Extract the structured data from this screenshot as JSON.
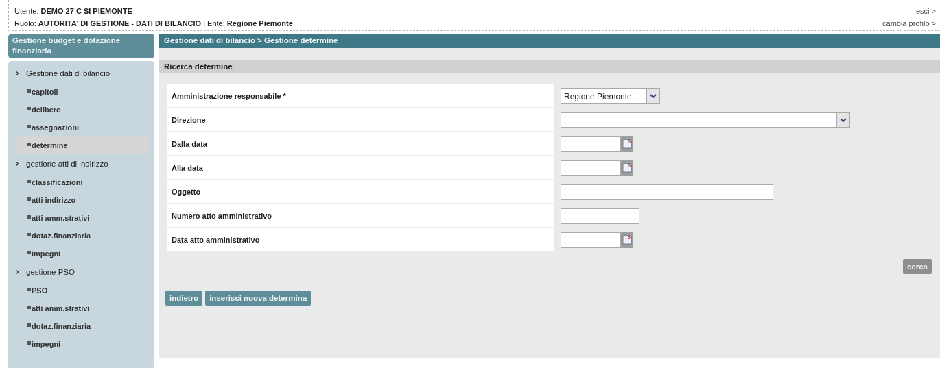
{
  "header": {
    "user": "Utente: **DEMO 27 C SI PIEMONTE**",
    "role": "Ruolo: **AUTORITA' DI GESTIONE - DATI DI BILANCIO** | Ente: **Regione Piemonte**",
    "links": [
      "esci >",
      "cambia profilo >"
    ]
  },
  "sidebar": {
    "title": "Gestione budget e dotazione finanziaria",
    "groups": [
      {
        "label": "Gestione dati di bilancio",
        "expanded": true,
        "children": [
          {
            "label": "capitoli",
            "selected": false
          },
          {
            "label": "delibere",
            "selected": false
          },
          {
            "label": "assegnazioni",
            "selected": false
          },
          {
            "label": "determine",
            "selected": true
          }
        ]
      },
      {
        "label": "gestione atti di indirizzo",
        "expanded": true,
        "children": [
          {
            "label": "classificazioni",
            "selected": false
          },
          {
            "label": "atti indirizzo",
            "selected": false
          },
          {
            "label": "atti amm.strativi",
            "selected": false
          },
          {
            "label": "dotaz.finanziaria",
            "selected": false
          },
          {
            "label": "impegni",
            "selected": false
          }
        ]
      },
      {
        "label": "gestione PSO",
        "expanded": true,
        "children": [
          {
            "label": "PSO",
            "selected": false
          },
          {
            "label": "atti amm.strativi",
            "selected": false
          },
          {
            "label": "dotaz.finanziaria",
            "selected": false
          },
          {
            "label": "impegni",
            "selected": false
          }
        ]
      }
    ]
  },
  "breadcrumb": "Gestione dati di bilancio > Gestione determine",
  "section_title": "Ricerca determine",
  "form": {
    "fields": [
      {
        "label": "Amministrazione responsabile *",
        "kind": "select",
        "value": "Regione Piemonte"
      },
      {
        "label": "Direzione",
        "kind": "select"
      },
      {
        "label": "Dalla data",
        "kind": "date"
      },
      {
        "label": "Alla data",
        "kind": "date"
      },
      {
        "label": "Oggetto",
        "kind": "text"
      },
      {
        "label": "Numero atto amministrativo",
        "kind": "text"
      },
      {
        "label": "Data atto amministrativo",
        "kind": "date"
      }
    ],
    "search_button": "cerca"
  },
  "buttons": [
    "indietro",
    "inserisci nuova determina"
  ]
}
